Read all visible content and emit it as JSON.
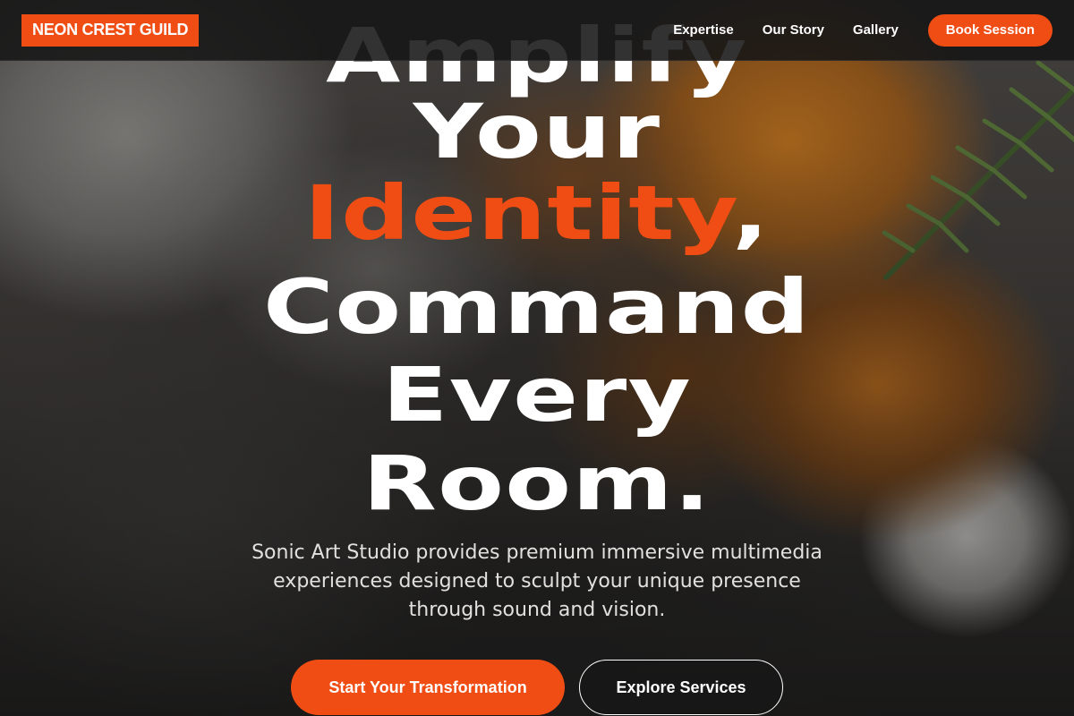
{
  "brand": {
    "logo_text": "NEON CREST GUILD",
    "accent_color": "#f04d14"
  },
  "nav": {
    "links": [
      "Expertise",
      "Our Story",
      "Gallery"
    ],
    "cta_label": "Book Session"
  },
  "hero": {
    "headline_lines": [
      "Amplify",
      "Your",
      "Identity",
      ",",
      "Command",
      "Every",
      "Room."
    ],
    "line_1": "Amplify",
    "line_2": "Your",
    "line_3_accent": "Identity",
    "line_3_punct": ",",
    "line_4": "Command",
    "line_5": "Every",
    "line_6": "Room.",
    "subtitle": "Sonic Art Studio provides premium immersive multimedia experiences designed to sculpt your unique presence through sound and vision.",
    "primary_cta": "Start Your Transformation",
    "secondary_cta": "Explore Services"
  }
}
